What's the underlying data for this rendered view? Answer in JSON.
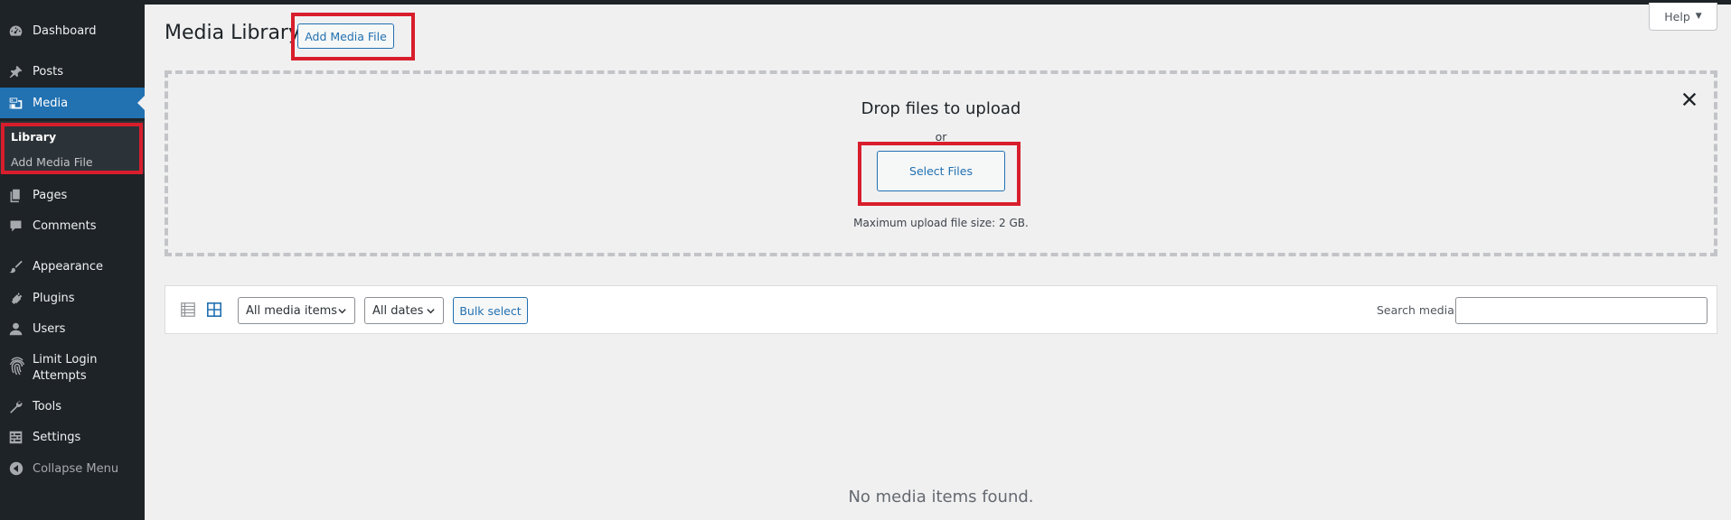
{
  "sidebar": {
    "items": [
      {
        "label": "Dashboard",
        "icon": "dashboard-icon"
      },
      {
        "label": "Posts",
        "icon": "pin-icon"
      },
      {
        "label": "Media",
        "icon": "media-icon"
      },
      {
        "label": "Pages",
        "icon": "pages-icon"
      },
      {
        "label": "Comments",
        "icon": "comments-icon"
      },
      {
        "label": "Appearance",
        "icon": "brush-icon"
      },
      {
        "label": "Plugins",
        "icon": "plugin-icon"
      },
      {
        "label": "Users",
        "icon": "user-icon"
      },
      {
        "label": "Limit Login",
        "label2": "Attempts",
        "icon": "fingerprint-icon"
      },
      {
        "label": "Tools",
        "icon": "wrench-icon"
      },
      {
        "label": "Settings",
        "icon": "settings-icon"
      },
      {
        "label": "Collapse Menu",
        "icon": "collapse-icon"
      }
    ],
    "submenu": [
      {
        "label": "Library"
      },
      {
        "label": "Add Media File"
      }
    ]
  },
  "header": {
    "title": "Media Library",
    "add_button": "Add Media File",
    "help": "Help"
  },
  "uploader": {
    "title": "Drop files to upload",
    "or": "or",
    "select_button": "Select Files",
    "max_size": "Maximum upload file size: 2 GB."
  },
  "toolbar": {
    "type_filter": "All media items",
    "date_filter": "All dates",
    "bulk_select": "Bulk select",
    "search_label": "Search media",
    "search_value": ""
  },
  "empty_message": "No media items found.",
  "colors": {
    "sidebar_bg": "#1d2327",
    "accent": "#2271b1",
    "highlight": "#d81e2c",
    "page_bg": "#f0f0f1"
  }
}
